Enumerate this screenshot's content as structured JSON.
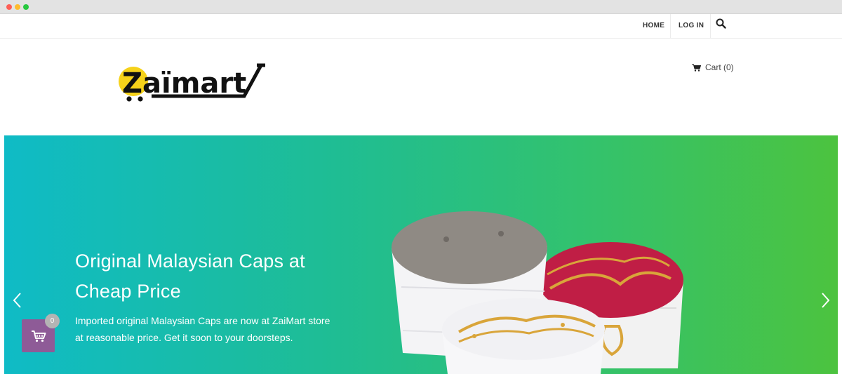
{
  "window": {
    "controls": [
      "close",
      "minimize",
      "maximize"
    ]
  },
  "nav": {
    "home_label": "HOME",
    "login_label": "LOG IN",
    "search_icon": "search-icon"
  },
  "header": {
    "logo_text": "Zaïmart",
    "cart_label": "Cart (0)",
    "cart_icon": "cart-icon"
  },
  "hero": {
    "title": "Original Malaysian Caps at Cheap Price",
    "subtitle": "Imported original Malaysian Caps are now at ZaiMart store at reasonable price. Get it soon to your doorsteps.",
    "prev_icon": "chevron-left-icon",
    "next_icon": "chevron-right-icon",
    "colors": {
      "start": "#0fbbc6",
      "end": "#4cc33f"
    }
  },
  "floating_cart": {
    "count": "0",
    "color": "#8e5b97"
  }
}
